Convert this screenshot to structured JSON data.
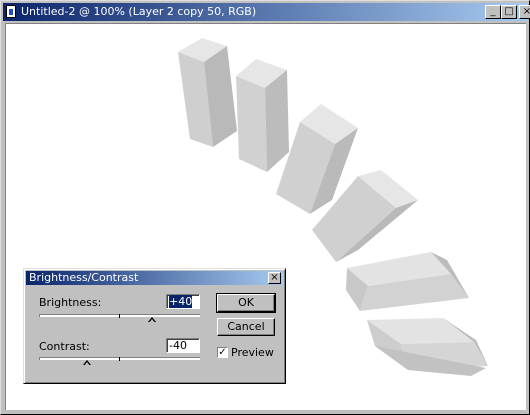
{
  "window": {
    "title": "Untitled-2 @ 100% (Layer 2 copy 50, RGB)",
    "minimize_glyph": "_",
    "maximize_glyph": "□",
    "close_glyph": "×"
  },
  "dialog": {
    "title": "Brightness/Contrast",
    "close_glyph": "×",
    "brightness": {
      "label": "Brightness:",
      "value": "+40",
      "level": 40,
      "min": -100,
      "max": 100
    },
    "contrast": {
      "label": "Contrast:",
      "value": "-40",
      "level": -40,
      "min": -100,
      "max": 100
    },
    "ok_label": "OK",
    "cancel_label": "Cancel",
    "preview": {
      "label": "Preview",
      "checked": true,
      "check_glyph": "✓"
    }
  },
  "colors": {
    "title_gradient_start": "#0a246a",
    "title_gradient_end": "#a6caf0",
    "face": "#c0c0c0",
    "canvas": "#ffffff"
  }
}
